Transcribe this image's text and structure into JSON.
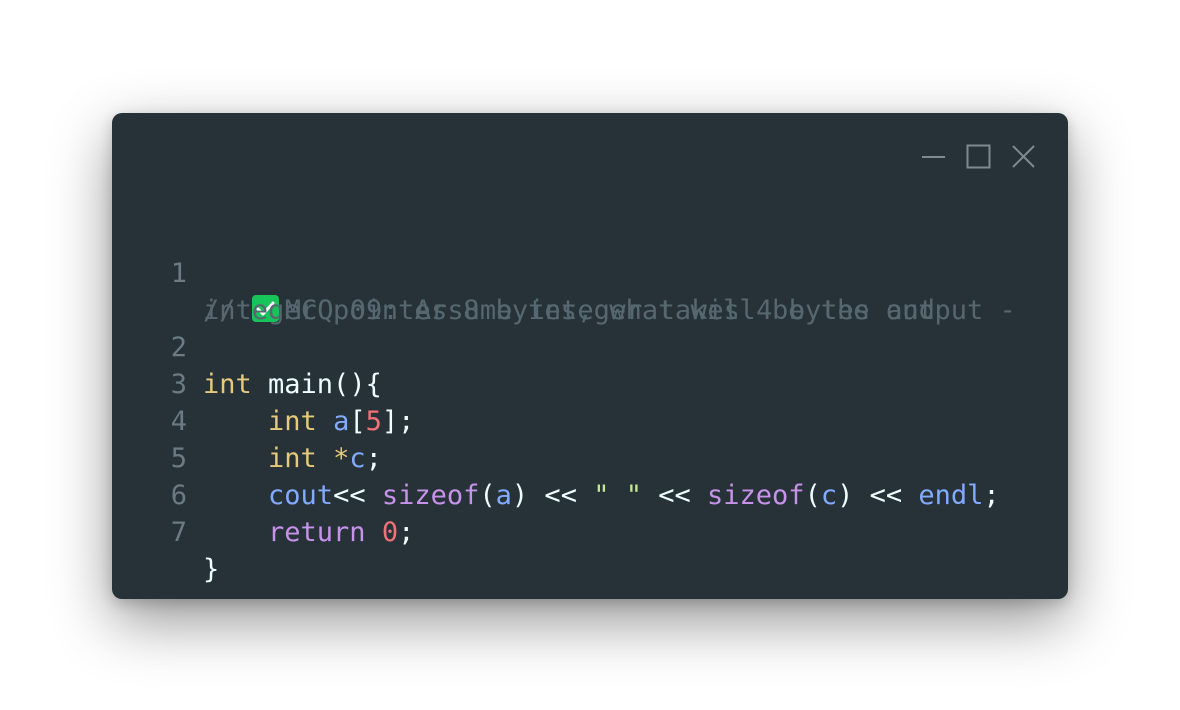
{
  "window": {
    "controls": {
      "minimize_icon": "minimize-icon",
      "maximize_icon": "maximize-icon",
      "close_icon": "close-icon"
    }
  },
  "code": {
    "line_numbers": [
      "1",
      "2",
      "3",
      "4",
      "5",
      "6",
      "7"
    ],
    "line1": {
      "comment_prefix": "// ",
      "check_icon": "check-mark-icon",
      "comment_text": "MCQ 09: Assume integer takes 4 bytes and",
      "comment_wrap": "integer pointer 8 bytes, what will be the output -"
    },
    "line2": {
      "kw": "int",
      "rest": " main(){"
    },
    "line3": {
      "indent": "    ",
      "kw": "int",
      "var": "a",
      "open": "[",
      "num": "5",
      "close": "];"
    },
    "line4": {
      "indent": "    ",
      "kw": "int",
      "star": "*",
      "var": "c",
      "end": ";"
    },
    "line5": {
      "indent": "    ",
      "cout": "cout",
      "op1": "<< ",
      "sizeof1": "sizeof",
      "p1o": "(",
      "a": "a",
      "p1c": ") << ",
      "str": "\" \"",
      "op2": " << ",
      "sizeof2": "sizeof",
      "p2o": "(",
      "c": "c",
      "p2c": ") << ",
      "endl": "endl",
      "semi": ";"
    },
    "line6": {
      "indent": "    ",
      "ret": "return",
      "num": "0",
      "semi": ";"
    },
    "line7": {
      "brace": "}"
    }
  },
  "colors": {
    "background": "#263238",
    "comment": "#56676f",
    "keyword": "#e6c97a",
    "identifier": "#82aaff",
    "number": "#f07178",
    "string": "#c3e88d",
    "control": "#c792ea",
    "plain": "#eeffff",
    "check_badge": "#16c45a"
  }
}
